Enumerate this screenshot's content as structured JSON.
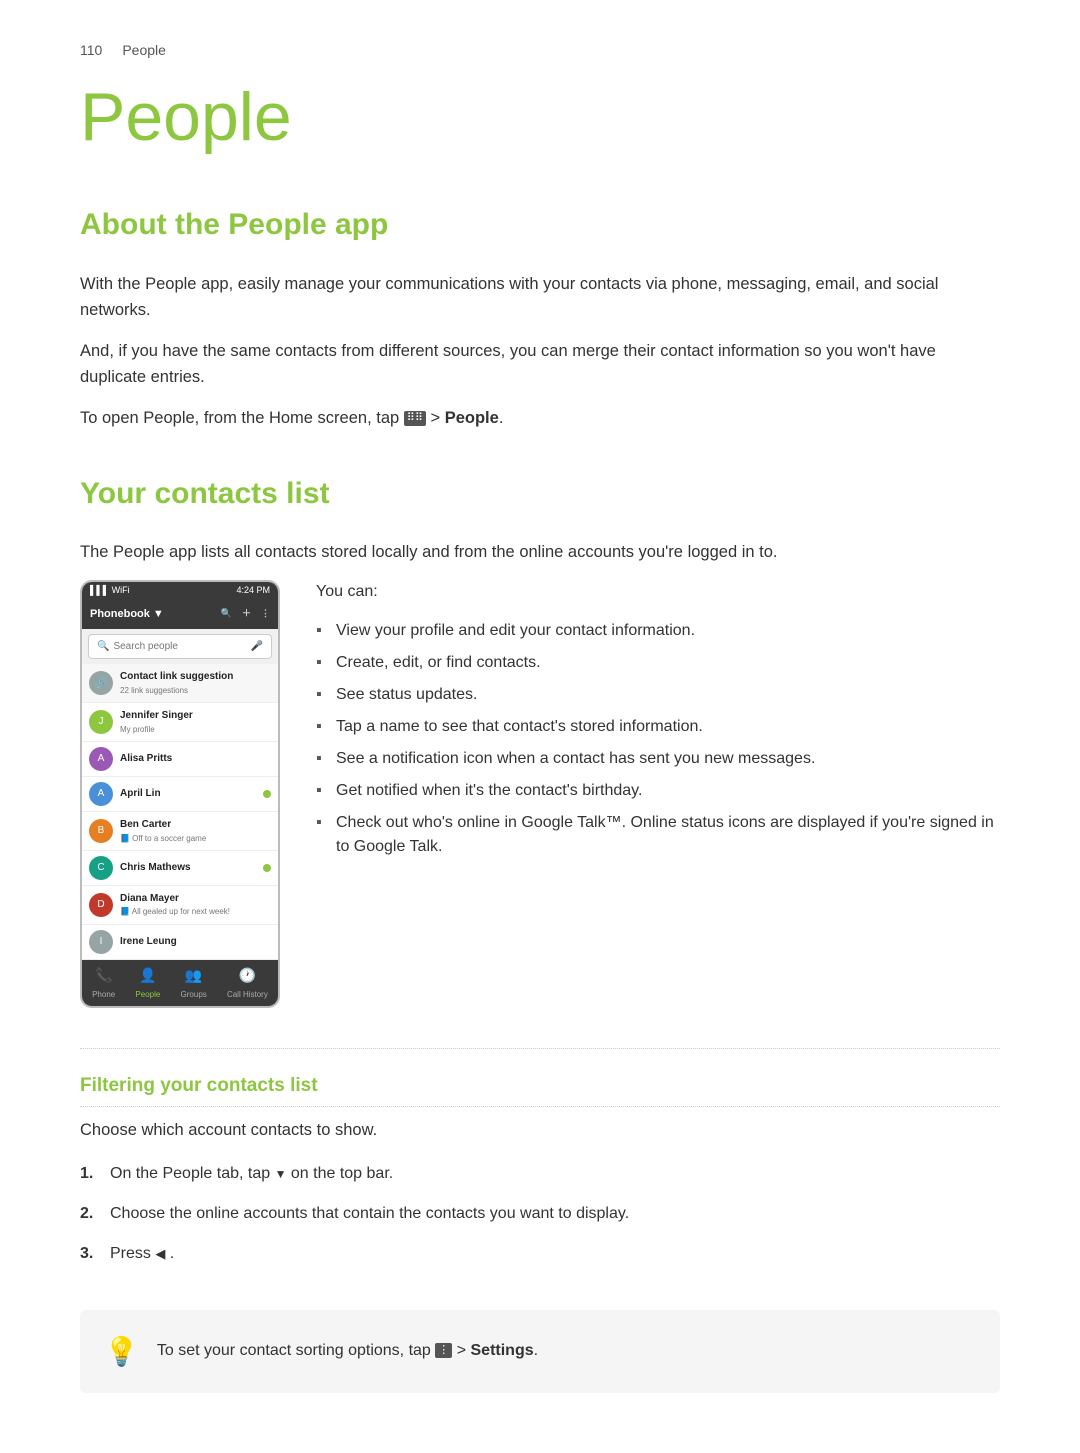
{
  "header": {
    "page_number": "110",
    "page_label": "People"
  },
  "page_title": "People",
  "sections": {
    "about": {
      "title": "About the People app",
      "paragraphs": [
        "With the People app, easily manage your communications with your contacts via phone, messaging, email, and social networks.",
        "And, if you have the same contacts from different sources, you can merge their contact information so you won't have duplicate entries.",
        "To open People, from the Home screen, tap"
      ],
      "open_instruction_suffix": " > People.",
      "open_instruction_bold": "People"
    },
    "contacts_list": {
      "title": "Your contacts list",
      "intro": "The People app lists all contacts stored locally and from the online accounts you're logged in to.",
      "you_can": "You can:",
      "bullets": [
        "View your profile and edit your contact information.",
        "Create, edit, or find contacts.",
        "See status updates.",
        "Tap a name to see that contact's stored information.",
        "See a notification icon when a contact has sent you new messages.",
        "Get notified when it's the contact's birthday.",
        "Check out who's online in Google Talk™. Online status icons are displayed if you're signed in to Google Talk."
      ],
      "phone": {
        "status_bar": {
          "signal": "▌▌▌",
          "wifi": "WiFi",
          "battery": "▐▐▐",
          "time": "4:24 PM"
        },
        "app_bar": {
          "label": "Phonebook",
          "dropdown_icon": "▼",
          "icons": [
            "Search",
            "Add",
            "Menu"
          ]
        },
        "search_placeholder": "Search people",
        "contacts": [
          {
            "name": "Contact link suggestion",
            "sub": "22 link suggestions",
            "avatar_type": "icon",
            "initial": "🔗"
          },
          {
            "name": "Jennifer Singer",
            "sub": "My profile",
            "avatar_type": "green",
            "initial": "J"
          },
          {
            "name": "Alisa Pritts",
            "sub": "",
            "avatar_type": "purple",
            "initial": "A"
          },
          {
            "name": "April Lin",
            "sub": "",
            "avatar_type": "blue",
            "initial": "A",
            "online": true
          },
          {
            "name": "Ben Carter",
            "sub": "Off to a soccer game",
            "avatar_type": "orange",
            "initial": "B",
            "facebook": true
          },
          {
            "name": "Chris Mathews",
            "sub": "",
            "avatar_type": "teal",
            "initial": "C",
            "online": true
          },
          {
            "name": "Diana Mayer",
            "sub": "All gealed up for next week!",
            "avatar_type": "red",
            "initial": "D",
            "facebook": true
          },
          {
            "name": "Irene Leung",
            "sub": "",
            "avatar_type": "gray",
            "initial": "I"
          }
        ],
        "bottom_tabs": [
          {
            "label": "Phone",
            "icon": "📞",
            "active": false
          },
          {
            "label": "People",
            "icon": "👤",
            "active": true
          },
          {
            "label": "Groups",
            "icon": "👥",
            "active": false
          },
          {
            "label": "Call History",
            "icon": "🕐",
            "active": false
          }
        ]
      }
    },
    "filtering": {
      "subtitle": "Filtering your contacts list",
      "intro": "Choose which account contacts to show.",
      "steps": [
        "On the People tab, tap ▼ on the top bar.",
        "Choose the online accounts that contain the contacts you want to display.",
        "Press ◀ ."
      ]
    },
    "tip": {
      "text": "To set your contact sorting options, tap",
      "suffix": " > Settings.",
      "suffix_bold": "Settings"
    }
  }
}
